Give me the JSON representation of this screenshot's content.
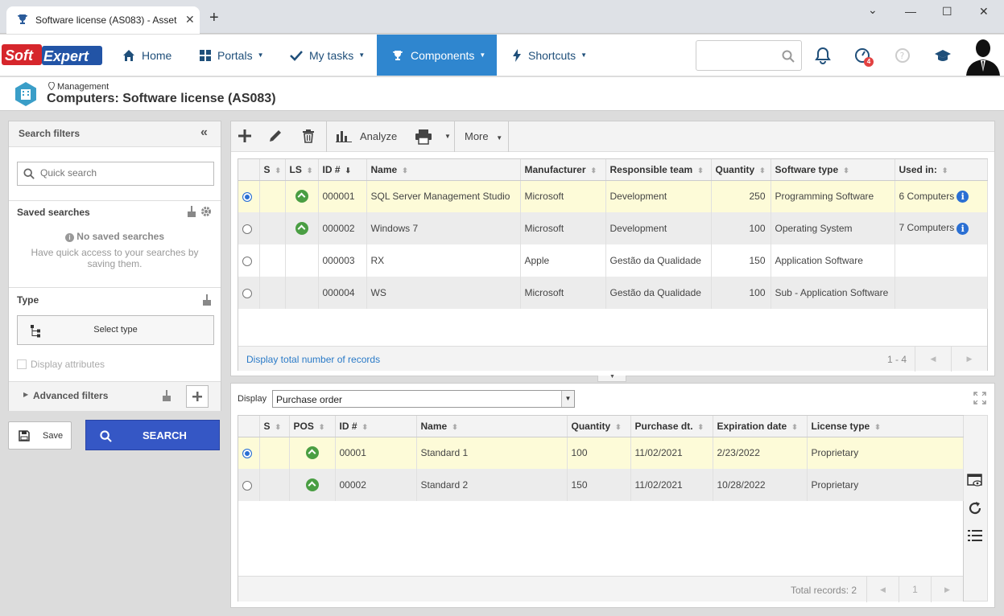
{
  "browser": {
    "tab_title": "Software license (AS083) - Asset",
    "close_glyph": "✕",
    "newtab_glyph": "+",
    "minimize_glyph": "⌄",
    "restore_glyph": "—",
    "maximize_glyph": "☐",
    "winclose_glyph": "✕"
  },
  "nav": {
    "logo_text": "SoftExpert",
    "items": [
      {
        "label": "Home",
        "icon": "home-icon"
      },
      {
        "label": "Portals",
        "icon": "grid-icon"
      },
      {
        "label": "My tasks",
        "icon": "check-icon"
      },
      {
        "label": "Components",
        "icon": "trophy-icon",
        "active": true
      },
      {
        "label": "Shortcuts",
        "icon": "bolt-icon"
      }
    ],
    "caret": "▼",
    "notification_badge": "4",
    "accent_color": "#2f86cf"
  },
  "breadcrumb": {
    "parent": "Management",
    "title": "Computers: Software license (AS083)"
  },
  "filters": {
    "title": "Search filters",
    "collapse_glyph": "«",
    "quick_search_placeholder": "Quick search",
    "saved_searches_label": "Saved searches",
    "no_saved_title": "No saved searches",
    "no_saved_desc": "Have quick access to your searches by saving them.",
    "type_label": "Type",
    "select_type_label": "Select type",
    "display_attributes_label": "Display attributes",
    "advanced_filters_label": "Advanced filters",
    "save_label": "Save",
    "search_label": "SEARCH"
  },
  "toolbar": {
    "analyze_label": "Analyze",
    "more_label": "More"
  },
  "grid1": {
    "columns": [
      "S",
      "LS",
      "ID #",
      "Name",
      "Manufacturer",
      "Responsible team",
      "Quantity",
      "Software type",
      "Used in:"
    ],
    "rows": [
      {
        "id": "000001",
        "name": "SQL Server Management Studio",
        "manufacturer": "Microsoft",
        "team": "Development",
        "quantity": "250",
        "type": "Programming Software",
        "used": "6 Computers",
        "ls": true,
        "selected": true
      },
      {
        "id": "000002",
        "name": "Windows 7",
        "manufacturer": "Microsoft",
        "team": "Development",
        "quantity": "100",
        "type": "Operating System",
        "used": "7 Computers",
        "ls": true,
        "selected": false
      },
      {
        "id": "000003",
        "name": "RX",
        "manufacturer": "Apple",
        "team": "Gestão da Qualidade",
        "quantity": "150",
        "type": "Application Software",
        "used": "",
        "ls": false,
        "selected": false
      },
      {
        "id": "000004",
        "name": "WS",
        "manufacturer": "Microsoft",
        "team": "Gestão da Qualidade",
        "quantity": "100",
        "type": "Sub - Application Software",
        "used": "",
        "ls": false,
        "selected": false
      }
    ],
    "footer_link": "Display total number of records",
    "pager": "1 - 4",
    "sort_glyph": "⬍",
    "sort_desc_glyph": "⬇",
    "prev_glyph": "◀",
    "next_glyph": "▶"
  },
  "display": {
    "label": "Display",
    "value": "Purchase order",
    "dd_glyph": "▼"
  },
  "grid2": {
    "columns": [
      "S",
      "POS",
      "ID #",
      "Name",
      "Quantity",
      "Purchase dt.",
      "Expiration date",
      "License type"
    ],
    "rows": [
      {
        "id": "00001",
        "name": "Standard 1",
        "quantity": "100",
        "purchase": "11/02/2021",
        "expiration": "2/23/2022",
        "license": "Proprietary",
        "selected": true
      },
      {
        "id": "00002",
        "name": "Standard 2",
        "quantity": "150",
        "purchase": "11/02/2021",
        "expiration": "10/28/2022",
        "license": "Proprietary",
        "selected": false
      }
    ],
    "total_records": "Total records: 2",
    "page": "1"
  }
}
